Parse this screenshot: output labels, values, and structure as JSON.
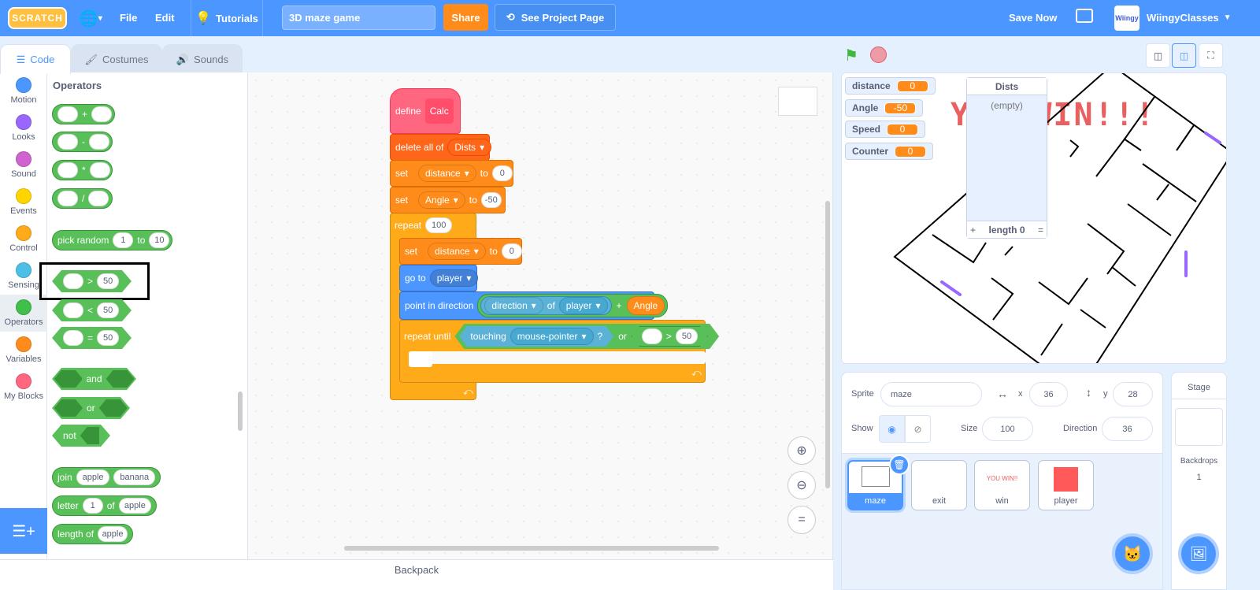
{
  "topbar": {
    "logo": "SCRATCH",
    "file": "File",
    "edit": "Edit",
    "tutorials": "Tutorials",
    "project_title": "3D maze game",
    "share": "Share",
    "see_project": "See Project Page",
    "save_now": "Save Now",
    "avatar": "Wiingy",
    "username": "WiingyClasses"
  },
  "tabs": {
    "code": "Code",
    "costumes": "Costumes",
    "sounds": "Sounds"
  },
  "categories": [
    {
      "label": "Motion",
      "color": "#4c97ff"
    },
    {
      "label": "Looks",
      "color": "#9966ff"
    },
    {
      "label": "Sound",
      "color": "#cf63cf"
    },
    {
      "label": "Events",
      "color": "#ffd500"
    },
    {
      "label": "Control",
      "color": "#ffab19"
    },
    {
      "label": "Sensing",
      "color": "#4cbfe6"
    },
    {
      "label": "Operators",
      "color": "#40bf4a"
    },
    {
      "label": "Variables",
      "color": "#ff8c1a"
    },
    {
      "label": "My Blocks",
      "color": "#ff6680"
    }
  ],
  "palette": {
    "heading": "Operators",
    "add": "+",
    "sub": "-",
    "mul": "*",
    "div": "/",
    "pick_random": "pick random",
    "rand_from": "1",
    "rand_to_label": "to",
    "rand_to": "10",
    "gt": ">",
    "lt": "<",
    "eq": "=",
    "cmp_value": "50",
    "and": "and",
    "or": "or",
    "not": "not",
    "join": "join",
    "join_a": "apple",
    "join_b": "banana",
    "letter": "letter",
    "letter_n": "1",
    "of": "of",
    "letter_s": "apple",
    "length_of": "length of",
    "length_s": "apple"
  },
  "script": {
    "define": "define",
    "proc": "Calc",
    "delete_all": "delete all of",
    "list": "Dists",
    "set": "set",
    "to": "to",
    "var_distance": "distance",
    "zero": "0",
    "var_angle": "Angle",
    "neg50": "-50",
    "repeat": "repeat",
    "times": "100",
    "go_to": "go to",
    "player": "player",
    "point_dir": "point in direction",
    "direction": "direction",
    "of": "of",
    "plus": "+",
    "angle": "Angle",
    "repeat_until": "repeat until",
    "touching": "touching",
    "mouse": "mouse-pointer",
    "q": "?",
    "or": "or",
    "gt": ">",
    "fifty": "50"
  },
  "backpack": "Backpack",
  "monitors": [
    {
      "name": "distance",
      "value": "0"
    },
    {
      "name": "Angle",
      "value": "-50"
    },
    {
      "name": "Speed",
      "value": "0"
    },
    {
      "name": "Counter",
      "value": "0"
    }
  ],
  "list_monitor": {
    "title": "Dists",
    "empty": "(empty)",
    "add": "+",
    "length": "length 0",
    "resize": "="
  },
  "stage_text": "YOU WIN!!!",
  "sprite_info": {
    "sprite_label": "Sprite",
    "sprite_name": "maze",
    "x_label": "x",
    "x": "36",
    "y_label": "y",
    "y": "28",
    "show_label": "Show",
    "size_label": "Size",
    "size": "100",
    "direction_label": "Direction",
    "direction": "36"
  },
  "sprites": [
    {
      "name": "maze",
      "selected": true
    },
    {
      "name": "exit"
    },
    {
      "name": "win",
      "thumb_text": "YOU WIN!!"
    },
    {
      "name": "player"
    }
  ],
  "stage_pane": {
    "title": "Stage",
    "backdrops_label": "Backdrops",
    "backdrops_count": "1"
  },
  "colors": {
    "accent": "#4c97ff",
    "operators": "#59c059",
    "control": "#ffab19",
    "variables": "#ff8c1a",
    "my_blocks": "#ff6680",
    "share": "#ff8c1a"
  }
}
